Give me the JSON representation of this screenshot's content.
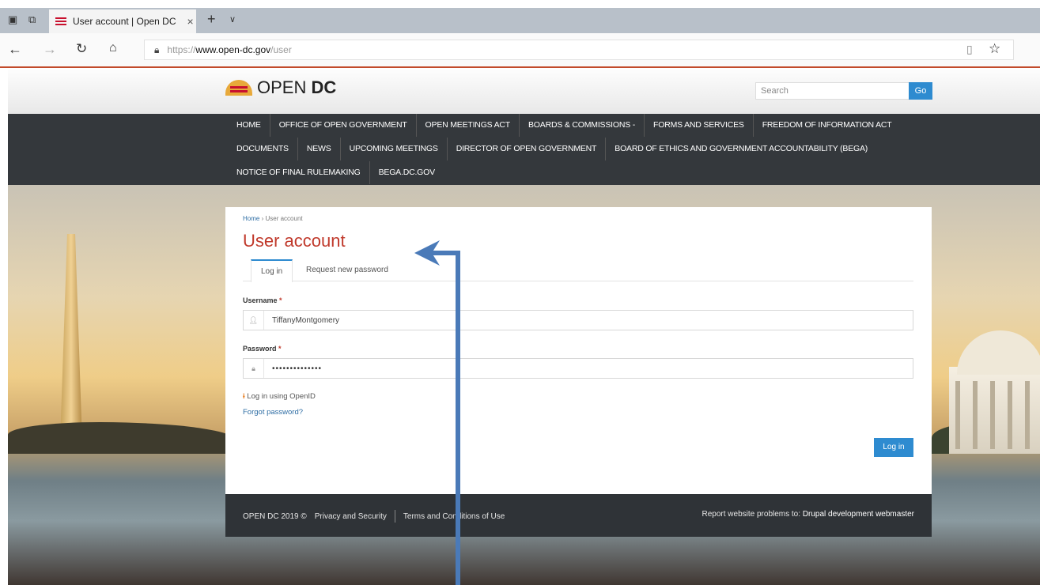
{
  "browser": {
    "tab_title": "User account | Open DC",
    "tab_close": "×",
    "new_tab": "+",
    "tab_dropdown": "∨",
    "url_protocol": "https://",
    "url_host": "www.open-dc.gov",
    "url_path": "/user",
    "icons": [
      "tab-preview-icon",
      "set-aside-tabs-icon",
      "back-icon",
      "forward-icon",
      "refresh-icon",
      "home-icon",
      "lock-icon",
      "reading-view-icon",
      "favorite-star-icon"
    ]
  },
  "site": {
    "logo_text_light": "OPEN",
    "logo_text_bold": "DC",
    "search_placeholder": "Search",
    "search_button": "Go"
  },
  "nav": {
    "row1": [
      "HOME",
      "OFFICE OF OPEN GOVERNMENT",
      "OPEN MEETINGS ACT",
      "BOARDS & COMMISSIONS -",
      "FORMS AND SERVICES",
      "FREEDOM OF INFORMATION ACT"
    ],
    "row2": [
      "DOCUMENTS",
      "NEWS",
      "UPCOMING MEETINGS",
      "DIRECTOR OF OPEN GOVERNMENT",
      "BOARD OF ETHICS AND GOVERNMENT ACCOUNTABILITY (BEGA)"
    ],
    "row3": [
      "NOTICE OF FINAL RULEMAKING",
      "BEGA.DC.GOV"
    ]
  },
  "page": {
    "breadcrumb_home": "Home",
    "breadcrumb_sep": "›",
    "breadcrumb_current": "User account",
    "title": "User account",
    "tabs": [
      "Log in",
      "Request new password"
    ],
    "username_label": "Username",
    "required_mark": "*",
    "username_value": "TiffanyMontgomery",
    "password_label": "Password",
    "password_value": "••••••••••••••",
    "openid_link": "Log in using OpenID",
    "forgot_link": "Forgot password?",
    "login_button": "Log in"
  },
  "footer": {
    "copyright": "OPEN DC 2019 ©",
    "privacy": "Privacy and Security",
    "terms": "Terms and Conditions of Use",
    "report_prefix": "Report website problems to:",
    "report_contact": "Drupal development webmaster"
  },
  "colors": {
    "accent_blue": "#2e8bd0",
    "title_red": "#c0392b",
    "nav_dark": "#34383c",
    "annotation_arrow": "#4a7ab8"
  }
}
